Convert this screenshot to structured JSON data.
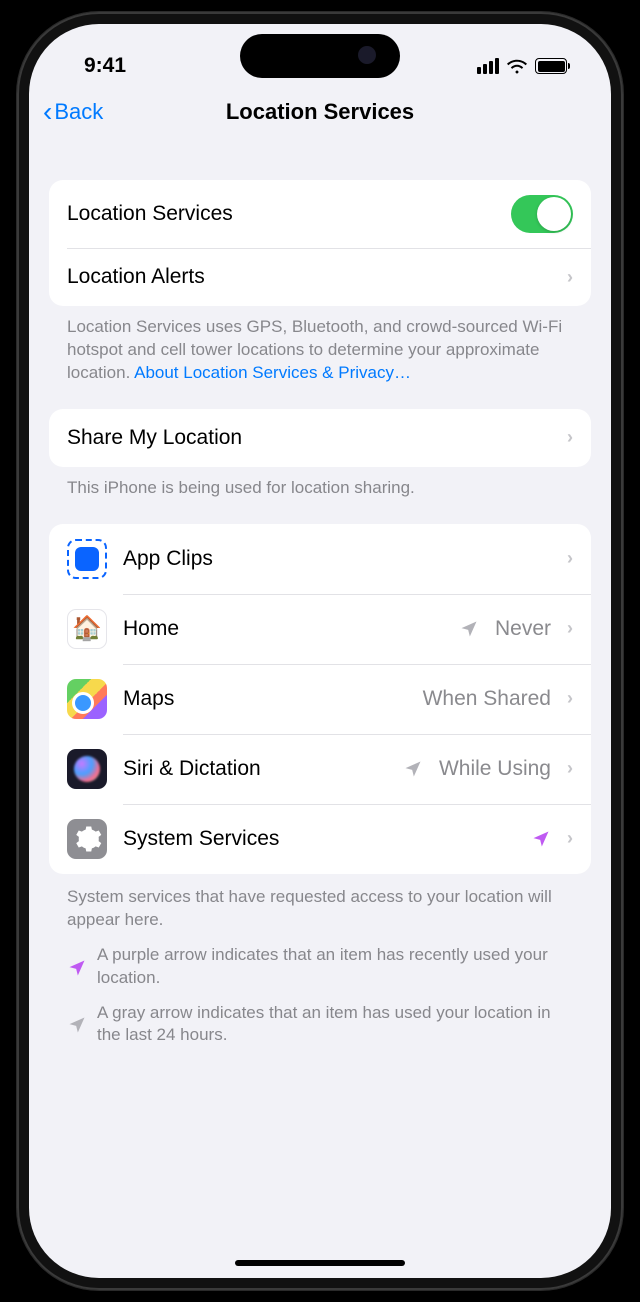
{
  "status": {
    "time": "9:41"
  },
  "nav": {
    "back": "Back",
    "title": "Location Services"
  },
  "group1": {
    "location_services": "Location Services",
    "location_alerts": "Location Alerts"
  },
  "footer1": {
    "text": "Location Services uses GPS, Bluetooth, and crowd-sourced Wi-Fi hotspot and cell tower locations to determine your approximate location. ",
    "link": "About Location Services & Privacy…"
  },
  "group2": {
    "share": "Share My Location"
  },
  "footer2": {
    "text": "This iPhone is being used for location sharing."
  },
  "apps": {
    "appclips": {
      "label": "App Clips",
      "value": ""
    },
    "home": {
      "label": "Home",
      "value": "Never"
    },
    "maps": {
      "label": "Maps",
      "value": "When Shared"
    },
    "siri": {
      "label": "Siri & Dictation",
      "value": "While Using"
    },
    "system": {
      "label": "System Services",
      "value": ""
    }
  },
  "footer3": {
    "text": "System services that have requested access to your location will appear here."
  },
  "legend": {
    "purple": "A purple arrow indicates that an item has recently used your location.",
    "gray": "A gray arrow indicates that an item has used your location in the last 24 hours."
  }
}
